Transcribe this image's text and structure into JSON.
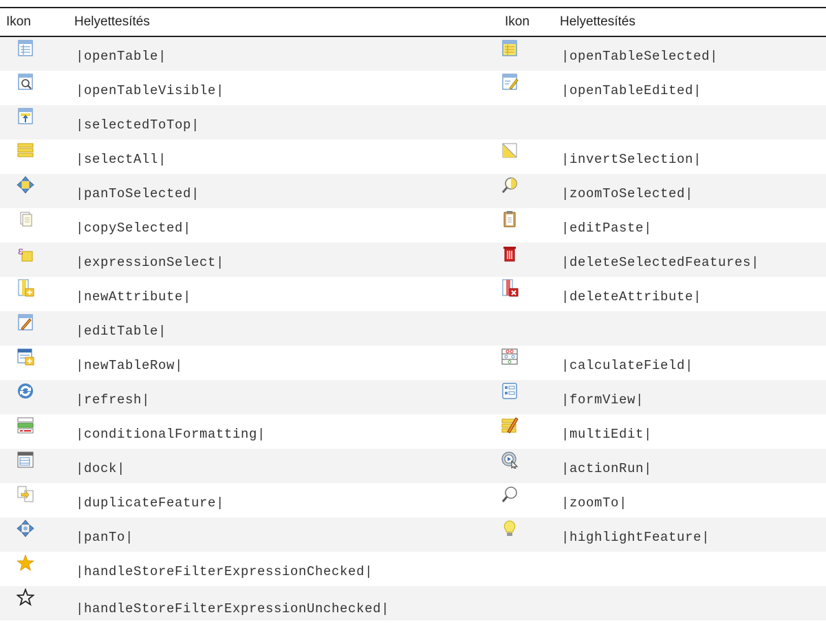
{
  "table": {
    "headers": {
      "icon1": "Ikon",
      "sub1": "Helyettesítés",
      "icon2": "Ikon",
      "sub2": "Helyettesítés"
    },
    "rows": [
      {
        "left": {
          "icon": "open-table-icon",
          "text": "|openTable|"
        },
        "right": {
          "icon": "open-table-selected-icon",
          "text": "|openTableSelected|"
        }
      },
      {
        "left": {
          "icon": "open-table-visible-icon",
          "text": "|openTableVisible|"
        },
        "right": {
          "icon": "open-table-edited-icon",
          "text": "|openTableEdited|"
        }
      },
      {
        "left": {
          "icon": "selected-to-top-icon",
          "text": "|selectedToTop|"
        },
        "right": null
      },
      {
        "left": {
          "icon": "select-all-icon",
          "text": "|selectAll|"
        },
        "right": {
          "icon": "invert-selection-icon",
          "text": "|invertSelection|"
        }
      },
      {
        "left": {
          "icon": "pan-to-selected-icon",
          "text": "|panToSelected|"
        },
        "right": {
          "icon": "zoom-to-selected-icon",
          "text": "|zoomToSelected|"
        }
      },
      {
        "left": {
          "icon": "copy-selected-icon",
          "text": "|copySelected|"
        },
        "right": {
          "icon": "edit-paste-icon",
          "text": "|editPaste|"
        }
      },
      {
        "left": {
          "icon": "expression-select-icon",
          "text": "|expressionSelect|"
        },
        "right": {
          "icon": "delete-selected-features-icon",
          "text": "|deleteSelectedFeatures|"
        }
      },
      {
        "left": {
          "icon": "new-attribute-icon",
          "text": "|newAttribute|"
        },
        "right": {
          "icon": "delete-attribute-icon",
          "text": "|deleteAttribute|"
        }
      },
      {
        "left": {
          "icon": "edit-table-icon",
          "text": "|editTable|"
        },
        "right": null
      },
      {
        "left": {
          "icon": "new-table-row-icon",
          "text": "|newTableRow|"
        },
        "right": {
          "icon": "calculate-field-icon",
          "text": "|calculateField|"
        }
      },
      {
        "left": {
          "icon": "refresh-icon",
          "text": "|refresh|"
        },
        "right": {
          "icon": "form-view-icon",
          "text": "|formView|"
        }
      },
      {
        "left": {
          "icon": "conditional-formatting-icon",
          "text": "|conditionalFormatting|"
        },
        "right": {
          "icon": "multi-edit-icon",
          "text": "|multiEdit|"
        }
      },
      {
        "left": {
          "icon": "dock-icon",
          "text": "|dock|"
        },
        "right": {
          "icon": "action-run-icon",
          "text": "|actionRun|"
        }
      },
      {
        "left": {
          "icon": "duplicate-feature-icon",
          "text": "|duplicateFeature|"
        },
        "right": {
          "icon": "zoom-to-icon",
          "text": "|zoomTo|"
        }
      },
      {
        "left": {
          "icon": "pan-to-icon",
          "text": "|panTo|"
        },
        "right": {
          "icon": "highlight-feature-icon",
          "text": "|highlightFeature|"
        }
      },
      {
        "left": {
          "icon": "star-filled-icon",
          "text": "|handleStoreFilterExpressionChecked|"
        },
        "right": null
      },
      {
        "left": {
          "icon": "star-outline-icon",
          "text": "|handleStoreFilterExpressionUnchecked|"
        },
        "right": null
      }
    ]
  },
  "colors": {
    "row_stripe": "#f3f3f3",
    "rule": "#222222",
    "icon_blue": "#5b8fc9",
    "icon_yellow": "#f3d84b",
    "icon_red": "#c92020",
    "star_gold": "#f5b800"
  }
}
